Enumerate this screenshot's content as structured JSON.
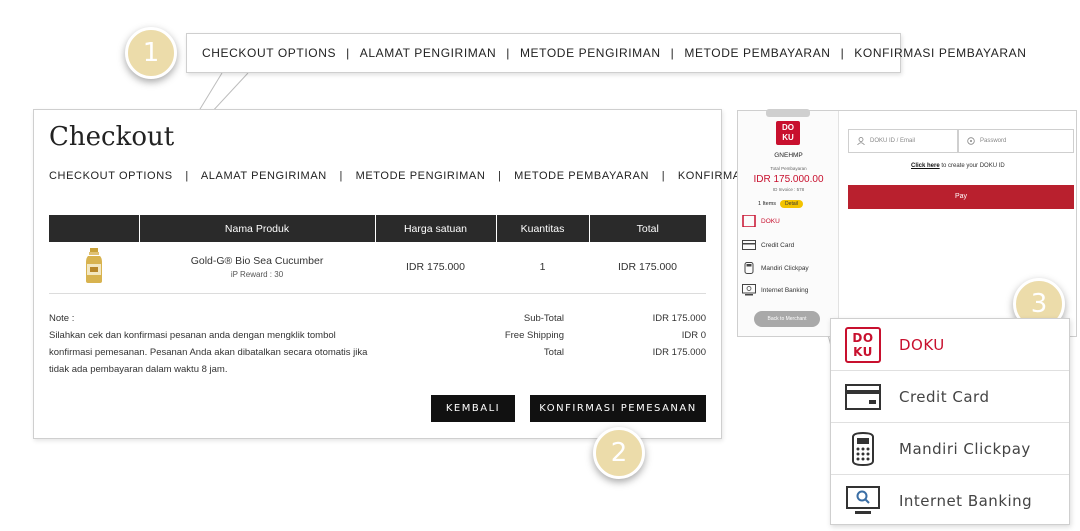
{
  "markers": {
    "one": "1",
    "two": "2",
    "three": "3"
  },
  "breadcrumb": {
    "items": [
      "CHECKOUT OPTIONS",
      "ALAMAT PENGIRIMAN",
      "METODE PENGIRIMAN",
      "METODE PEMBAYARAN",
      "KONFIRMASI PEMBAYARAN"
    ],
    "separator": "|"
  },
  "checkout": {
    "title": "Checkout",
    "table": {
      "headers": [
        "",
        "Nama Produk",
        "Harga satuan",
        "Kuantitas",
        "Total"
      ],
      "row": {
        "product_name": "Gold-G® Bio Sea Cucumber",
        "reward": "iP Reward : 30",
        "price": "IDR 175.000",
        "quantity": "1",
        "total": "IDR 175.000"
      }
    },
    "note": {
      "label": "Note :",
      "text": "Silahkan cek dan konfirmasi pesanan anda dengan mengklik tombol konfirmasi pemesanan. Pesanan Anda akan dibatalkan secara otomatis jika tidak ada pembayaran dalam waktu 8 jam."
    },
    "totals": [
      {
        "label": "Sub-Total",
        "value": "IDR 175.000"
      },
      {
        "label": "Free Shipping",
        "value": "IDR 0"
      },
      {
        "label": "Total",
        "value": "IDR 175.000"
      }
    ],
    "buttons": {
      "back": "KEMBALI",
      "confirm": "KONFIRMASI PEMESANAN"
    }
  },
  "payment": {
    "logo_text": "DO KU",
    "merchant": "GNEHMP",
    "total_label": "Total Pembayaran",
    "amount": "IDR 175.000.00",
    "invoice": "ID Invoice : 578",
    "items": "1 Items",
    "detail": "Detail",
    "methods": [
      "DOKU",
      "Credit Card",
      "Mandiri Clickpay",
      "Internet Banking"
    ],
    "back_to_merchant": "Back to Merchant",
    "doku_id_placeholder": "DOKU ID / Email",
    "password_placeholder": "Password",
    "create_link": "Click here",
    "create_text": " to create your DOKU ID",
    "pay_button": "Pay"
  },
  "colors": {
    "accent_red": "#c8102e",
    "dark": "#2a2a2a",
    "marker": "#ecdcaa"
  }
}
